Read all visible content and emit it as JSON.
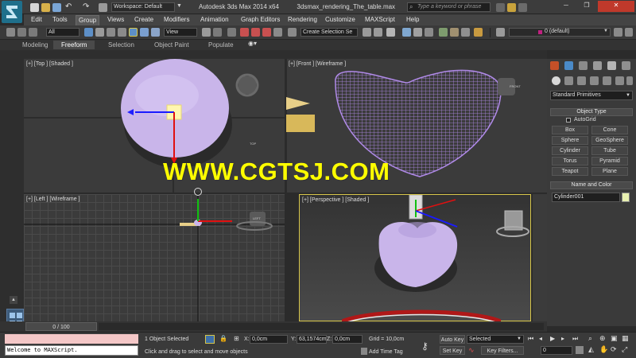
{
  "app": {
    "title": "Autodesk 3ds Max 2014 x64",
    "file": "3dsmax_rendering_The_table.max",
    "workspace": "Workspace: Default",
    "search_placeholder": "Type a keyword or phrase"
  },
  "menu": [
    "Edit",
    "Tools",
    "Group",
    "Views",
    "Create",
    "Modifiers",
    "Animation",
    "Graph Editors",
    "Rendering",
    "Customize",
    "MAXScript",
    "Help"
  ],
  "toolbar": {
    "filter": "All",
    "ref_coord": "View",
    "selection_set": "Create Selection Se",
    "layer": "0 (default)"
  },
  "ribbon_tabs": [
    "Modeling",
    "Freeform",
    "Selection",
    "Object Paint",
    "Populate"
  ],
  "viewports": {
    "top": "[+] [Top ] [Shaded ]",
    "front": "[+] [Front ] [Wireframe ]",
    "left": "[+] [Left ] [Wireframe ]",
    "persp": "[+] [Perspective ] [Shaded ]"
  },
  "viewcube": {
    "top": "TOP",
    "front": "FRONT",
    "left": "LEFT"
  },
  "watermark": "WWW.CGTSJ.COM",
  "command_panel": {
    "category": "Standard Primitives",
    "object_type_header": "Object Type",
    "autogrid": "AutoGrid",
    "buttons": [
      "Box",
      "Cone",
      "Sphere",
      "GeoSphere",
      "Cylinder",
      "Tube",
      "Torus",
      "Pyramid",
      "Teapot",
      "Plane"
    ],
    "name_color_header": "Name and Color",
    "object_name": "Cylinder001"
  },
  "timeline": {
    "frame": "0 / 100"
  },
  "status": {
    "maxscript": "Welcome to MAXScript.",
    "selected": "1 Object Selected",
    "prompt": "Click and drag to select and move objects",
    "x": "0,0cm",
    "y": "63,1574cm",
    "z": "0,0cm",
    "grid": "Grid = 10,0cm",
    "add_time_tag": "Add Time Tag",
    "auto_key": "Auto Key",
    "selected_mode": "Selected",
    "set_key": "Set Key",
    "key_filters": "Key Filters...",
    "current_frame": "0",
    "x_label": "X:",
    "y_label": "Y:",
    "z_label": "Z:"
  },
  "colors": {
    "object": "#c9b5ea",
    "wire": "#b08ae8",
    "selection_border": "#d7c64a",
    "watermark": "#ffff00",
    "name_swatch": "#e8f0b0"
  }
}
